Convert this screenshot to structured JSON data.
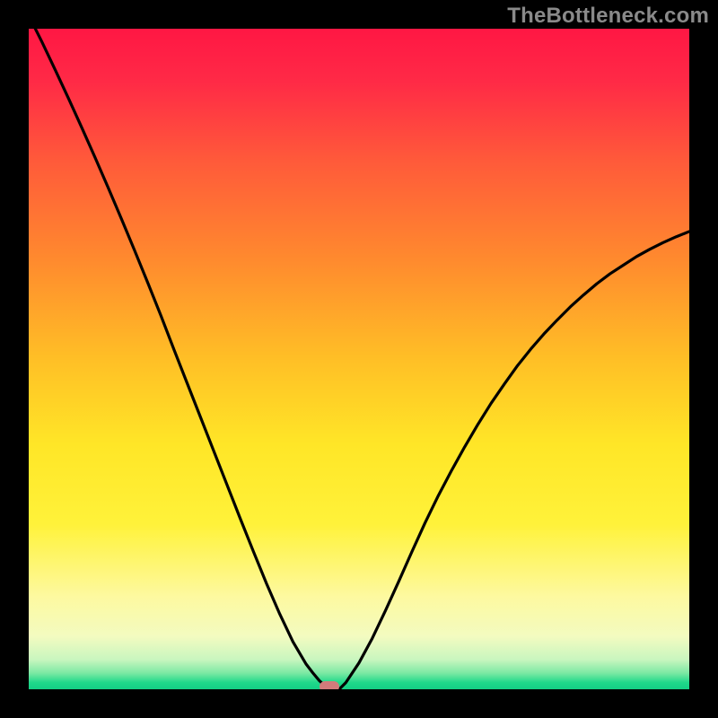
{
  "watermark": "TheBottleneck.com",
  "colors": {
    "black": "#000000",
    "curve": "#000000",
    "marker": "#d27b7b",
    "watermark": "#8a8a8a",
    "gradient_stops": [
      {
        "stop": 0.0,
        "color": "#ff1744"
      },
      {
        "stop": 0.08,
        "color": "#ff2a46"
      },
      {
        "stop": 0.2,
        "color": "#ff5a3a"
      },
      {
        "stop": 0.35,
        "color": "#ff8a2e"
      },
      {
        "stop": 0.5,
        "color": "#ffbf26"
      },
      {
        "stop": 0.63,
        "color": "#ffe627"
      },
      {
        "stop": 0.75,
        "color": "#fff23a"
      },
      {
        "stop": 0.86,
        "color": "#fdf9a0"
      },
      {
        "stop": 0.92,
        "color": "#f3fbc0"
      },
      {
        "stop": 0.955,
        "color": "#c9f6bf"
      },
      {
        "stop": 0.975,
        "color": "#7ee9a4"
      },
      {
        "stop": 0.99,
        "color": "#1fd98a"
      },
      {
        "stop": 1.0,
        "color": "#14cf84"
      }
    ]
  },
  "plot": {
    "x_range": [
      0,
      1
    ],
    "y_range": [
      0,
      1
    ]
  },
  "chart_data": {
    "type": "line",
    "title": "",
    "xlabel": "",
    "ylabel": "",
    "xlim": [
      0,
      1
    ],
    "ylim": [
      0,
      1
    ],
    "min_marker": {
      "x": 0.455,
      "y": 0.0
    },
    "series": [
      {
        "name": "curve",
        "x": [
          0.0,
          0.02,
          0.04,
          0.06,
          0.08,
          0.1,
          0.12,
          0.14,
          0.16,
          0.18,
          0.2,
          0.22,
          0.24,
          0.26,
          0.28,
          0.3,
          0.32,
          0.34,
          0.36,
          0.38,
          0.4,
          0.42,
          0.43,
          0.44,
          0.45,
          0.46,
          0.47,
          0.48,
          0.5,
          0.52,
          0.54,
          0.56,
          0.58,
          0.6,
          0.62,
          0.64,
          0.66,
          0.68,
          0.7,
          0.72,
          0.74,
          0.76,
          0.78,
          0.8,
          0.82,
          0.84,
          0.86,
          0.88,
          0.9,
          0.92,
          0.94,
          0.96,
          0.98,
          1.0
        ],
        "values": [
          1.02,
          0.98,
          0.938,
          0.895,
          0.851,
          0.806,
          0.76,
          0.713,
          0.665,
          0.616,
          0.566,
          0.514,
          0.463,
          0.412,
          0.361,
          0.31,
          0.259,
          0.209,
          0.16,
          0.114,
          0.072,
          0.038,
          0.025,
          0.013,
          0.004,
          0.0,
          0.0,
          0.01,
          0.04,
          0.077,
          0.119,
          0.163,
          0.208,
          0.252,
          0.293,
          0.331,
          0.367,
          0.401,
          0.433,
          0.462,
          0.49,
          0.515,
          0.538,
          0.559,
          0.579,
          0.597,
          0.614,
          0.629,
          0.642,
          0.655,
          0.666,
          0.676,
          0.685,
          0.693
        ]
      }
    ]
  }
}
